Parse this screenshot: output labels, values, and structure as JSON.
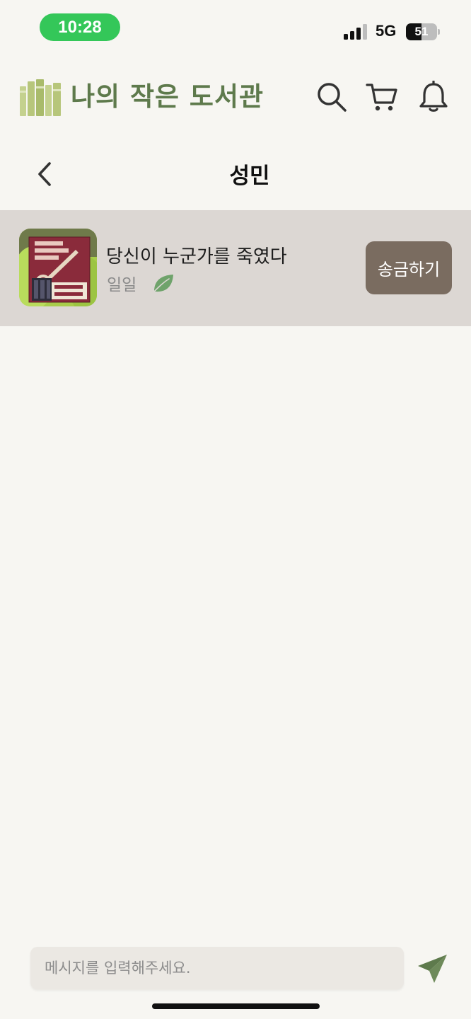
{
  "status_bar": {
    "time": "10:28",
    "network": "5G",
    "battery_level": "51",
    "battery_fraction": 0.51
  },
  "header": {
    "logo_title": "나의 작은 도서관",
    "brand_color": "#5e7a4c",
    "icons": [
      "search-icon",
      "cart-icon",
      "bell-icon"
    ]
  },
  "nav": {
    "title": "성민",
    "back_icon": "chevron-left-icon"
  },
  "product": {
    "title": "당신이 누군가를 죽였다",
    "seller": "일일",
    "badge_icon": "leaf-icon",
    "action_label": "송금하기",
    "action_color": "#7a6c60"
  },
  "composer": {
    "placeholder": "메시지를 입력해주세요.",
    "value": "",
    "send_icon": "send-icon",
    "send_color": "#5e7a4c"
  }
}
